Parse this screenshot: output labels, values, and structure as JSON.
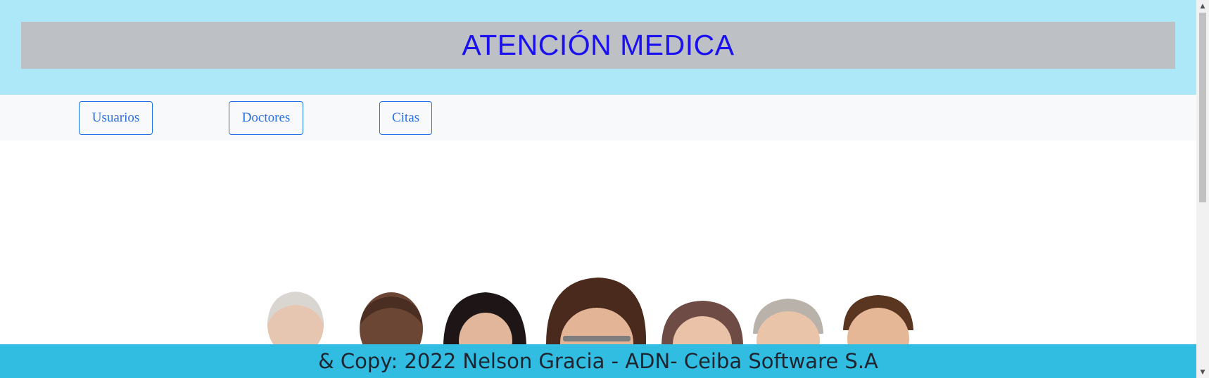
{
  "header": {
    "title": "ATENCIÓN MEDICA"
  },
  "nav": {
    "items": [
      {
        "label": "Usuarios"
      },
      {
        "label": "Doctores"
      },
      {
        "label": "Citas"
      }
    ]
  },
  "hero": {
    "image": "group-of-medical-professionals-photo"
  },
  "footer": {
    "text": "& Copy: 2022 Nelson Gracia - ADN- Ceiba Software S.A"
  },
  "colors": {
    "header_bg": "#ade8f8",
    "title_box_bg": "#bdc1c6",
    "title_text": "#1a10f0",
    "nav_bg": "#f8f9fa",
    "button_border": "#1f6feb",
    "footer_bg": "#31bde2"
  }
}
